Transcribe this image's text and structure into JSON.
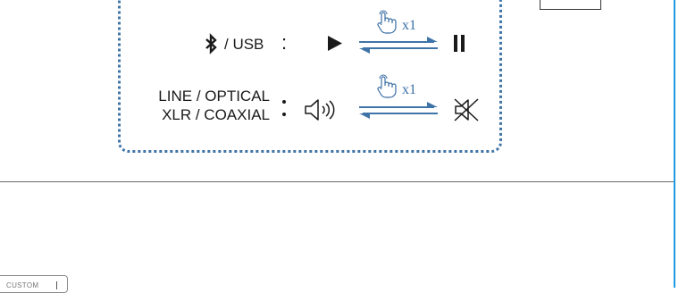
{
  "rows": {
    "bt_usb": {
      "source_label": "/ USB",
      "separator": ":",
      "multiplier": "x1",
      "state_a_icon": "play-icon",
      "state_b_icon": "pause-icon"
    },
    "line_optical": {
      "source_label_line1": "LINE / OPTICAL",
      "source_label_line2": "XLR / COAXIAL",
      "multiplier": "x1",
      "state_a_icon": "speaker-on-icon",
      "state_b_icon": "speaker-mute-icon"
    }
  },
  "bottom": {
    "custom_label": "CUSTOM"
  },
  "colors": {
    "accent_blue": "#3f74a8",
    "frame_blue": "#1e9be0"
  }
}
